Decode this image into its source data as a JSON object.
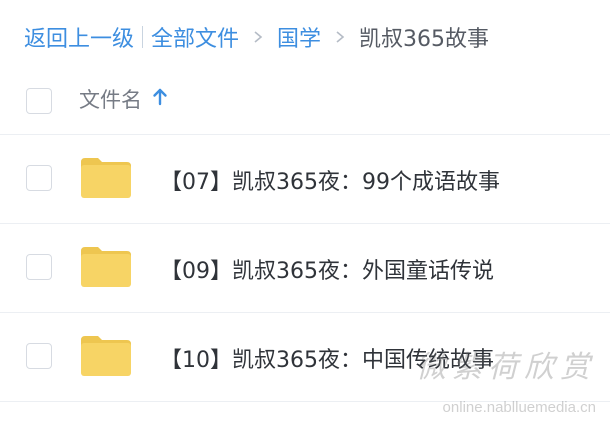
{
  "breadcrumb": {
    "back_label": "返回上一级",
    "all_files_label": "全部文件",
    "level1_label": "国学",
    "current_label": "凯叔365故事"
  },
  "list_header": {
    "name_column_label": "文件名",
    "sort_direction": "ascending"
  },
  "files": [
    {
      "name": "【07】凯叔365夜：99个成语故事",
      "type": "folder"
    },
    {
      "name": "【09】凯叔365夜：外国童话传说",
      "type": "folder"
    },
    {
      "name": "【10】凯叔365夜：中国传统故事",
      "type": "folder"
    }
  ],
  "watermark": {
    "text": "微紫荷欣赏",
    "url": "online.nablluemedia.cn"
  },
  "colors": {
    "accent": "#3d8ee0",
    "folder": "#f7d465",
    "folder_tab": "#eec650",
    "text_primary": "#2f3339",
    "text_secondary": "#767b85"
  },
  "icons": {
    "sort": "arrow-up-icon",
    "folder": "folder-icon",
    "separator": "chevron-right-icon"
  }
}
